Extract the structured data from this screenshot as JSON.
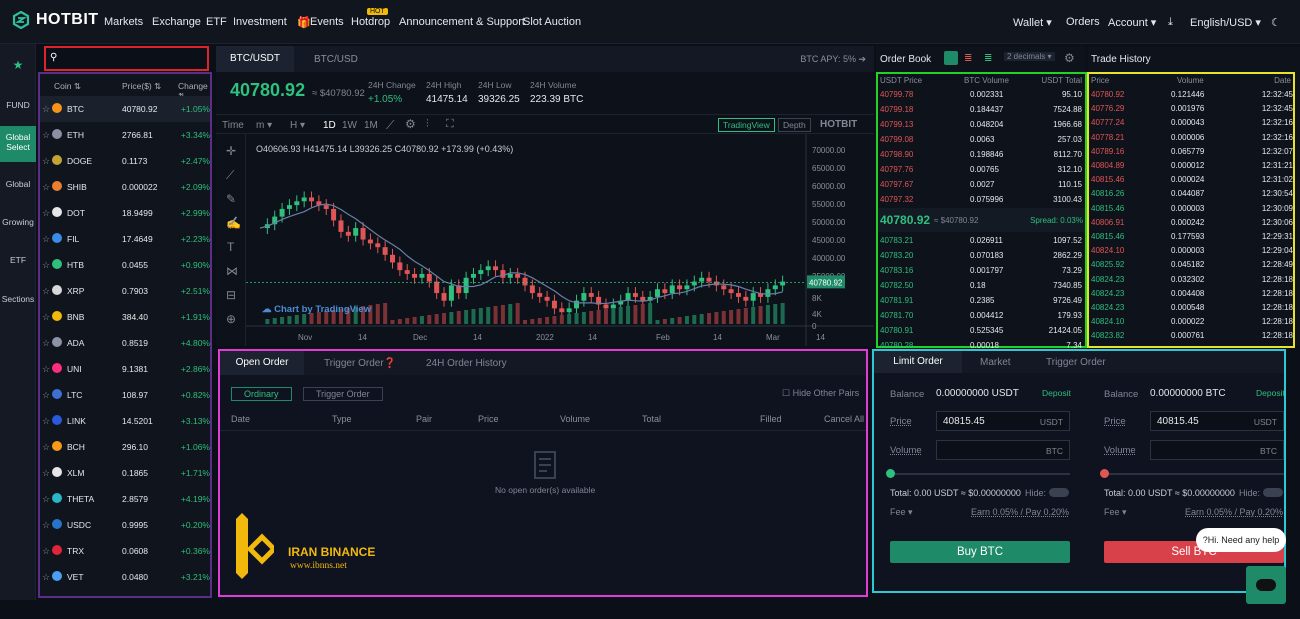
{
  "nav": {
    "brand": "HOTBIT",
    "items": [
      "Markets",
      "Exchange",
      "ETF",
      "Investment",
      "Events",
      "Hotdrop",
      "Announcement & Support",
      "Slot Auction"
    ],
    "hot_badge": "HOT",
    "right": [
      "Wallet",
      "Orders",
      "Account",
      "English/USD"
    ]
  },
  "leftbar": {
    "items": [
      "FUND",
      "Global Select",
      "Global",
      "Growing",
      "ETF",
      "Sections"
    ]
  },
  "coinlist": {
    "headers": [
      "Coin",
      "Price($)",
      "Change"
    ],
    "rows": [
      {
        "sym": "BTC",
        "price": "40780.92",
        "chg": "+1.05%",
        "color": "#f7931a"
      },
      {
        "sym": "ETH",
        "price": "2766.81",
        "chg": "+3.34%",
        "color": "#8a8fa3"
      },
      {
        "sym": "DOGE",
        "price": "0.1173",
        "chg": "+2.47%",
        "color": "#c2a633"
      },
      {
        "sym": "SHIB",
        "price": "0.000022",
        "chg": "+2.09%",
        "color": "#e8802f"
      },
      {
        "sym": "DOT",
        "price": "18.9499",
        "chg": "+2.99%",
        "color": "#e6e6e6"
      },
      {
        "sym": "FIL",
        "price": "17.4649",
        "chg": "+2.23%",
        "color": "#3b8be8"
      },
      {
        "sym": "HTB",
        "price": "0.0455",
        "chg": "+0.90%",
        "color": "#2fbf7e"
      },
      {
        "sym": "XRP",
        "price": "0.7903",
        "chg": "+2.51%",
        "color": "#d8d8d8"
      },
      {
        "sym": "BNB",
        "price": "384.40",
        "chg": "+1.91%",
        "color": "#f0b90b"
      },
      {
        "sym": "ADA",
        "price": "0.8519",
        "chg": "+4.80%",
        "color": "#8b93a6"
      },
      {
        "sym": "UNI",
        "price": "9.1381",
        "chg": "+2.86%",
        "color": "#ff2d7a"
      },
      {
        "sym": "LTC",
        "price": "108.97",
        "chg": "+0.82%",
        "color": "#3f6fd6"
      },
      {
        "sym": "LINK",
        "price": "14.5201",
        "chg": "+3.13%",
        "color": "#2a5ada"
      },
      {
        "sym": "BCH",
        "price": "296.10",
        "chg": "+1.06%",
        "color": "#f79a1a"
      },
      {
        "sym": "XLM",
        "price": "0.1865",
        "chg": "+1.71%",
        "color": "#e6e6e6"
      },
      {
        "sym": "THETA",
        "price": "2.8579",
        "chg": "+4.19%",
        "color": "#29b6c6"
      },
      {
        "sym": "USDC",
        "price": "0.9995",
        "chg": "+0.20%",
        "color": "#2775ca"
      },
      {
        "sym": "TRX",
        "price": "0.0608",
        "chg": "+0.36%",
        "color": "#e0243a"
      },
      {
        "sym": "VET",
        "price": "0.0480",
        "chg": "+3.21%",
        "color": "#4a9ff0"
      }
    ]
  },
  "chart": {
    "tabs": [
      "BTC/USDT",
      "BTC/USD"
    ],
    "apy": "BTC APY: 5%",
    "last_price": "40780.92",
    "last_usd": "≈ $40780.92",
    "stats": [
      {
        "label": "24H Change",
        "value": "+1.05%"
      },
      {
        "label": "24H High",
        "value": "41475.14"
      },
      {
        "label": "24H Low",
        "value": "39326.25"
      },
      {
        "label": "24H Volume",
        "value": "223.39 BTC"
      }
    ],
    "toolbar": [
      "Time",
      "m",
      "H",
      "1D",
      "1W",
      "1M"
    ],
    "view_buttons": [
      "TradingView",
      "Depth"
    ],
    "ohlc": "O40606.93 H41475.14 L39326.25 C40780.92 +173.99 (+0.43%)",
    "watermark": "Chart by TradingView",
    "yticks": [
      "70000.00",
      "65000.00",
      "60000.00",
      "55000.00",
      "50000.00",
      "45000.00",
      "40000.00",
      "35000.00",
      "8K",
      "4K",
      "0"
    ],
    "xticks": [
      "Nov",
      "14",
      "Dec",
      "14",
      "2022",
      "14",
      "Feb",
      "14",
      "Mar",
      "14"
    ],
    "price_tag": "40780.92"
  },
  "orderbook": {
    "title": "Order Book",
    "decimals": "2 decimals",
    "headers": [
      "USDT Price",
      "BTC Volume",
      "USDT Total"
    ],
    "asks": [
      [
        "40799.78",
        "0.002331",
        "95.10"
      ],
      [
        "40799.18",
        "0.184437",
        "7524.88"
      ],
      [
        "40799.13",
        "0.048204",
        "1966.68"
      ],
      [
        "40799.08",
        "0.0063",
        "257.03"
      ],
      [
        "40798.90",
        "0.198846",
        "8112.70"
      ],
      [
        "40797.76",
        "0.00765",
        "312.10"
      ],
      [
        "40797.67",
        "0.0027",
        "110.15"
      ],
      [
        "40797.32",
        "0.075996",
        "3100.43"
      ]
    ],
    "mid_price": "40780.92",
    "mid_usd": "≈ $40780.92",
    "spread": "Spread: 0.03%",
    "bids": [
      [
        "40783.21",
        "0.026911",
        "1097.52"
      ],
      [
        "40783.20",
        "0.070183",
        "2862.29"
      ],
      [
        "40783.16",
        "0.001797",
        "73.29"
      ],
      [
        "40782.50",
        "0.18",
        "7340.85"
      ],
      [
        "40781.91",
        "0.2385",
        "9726.49"
      ],
      [
        "40781.70",
        "0.004412",
        "179.93"
      ],
      [
        "40780.91",
        "0.525345",
        "21424.05"
      ],
      [
        "40780.28",
        "0.00018",
        "7.34"
      ]
    ]
  },
  "tradehistory": {
    "title": "Trade History",
    "headers": [
      "Price",
      "Volume",
      "Date"
    ],
    "rows": [
      [
        "40780.92",
        "0.121446",
        "12:32:45",
        "red"
      ],
      [
        "40776.29",
        "0.001976",
        "12:32:45",
        "red"
      ],
      [
        "40777.24",
        "0.000043",
        "12:32:16",
        "red"
      ],
      [
        "40778.21",
        "0.000006",
        "12:32:16",
        "red"
      ],
      [
        "40789.16",
        "0.065779",
        "12:32:07",
        "red"
      ],
      [
        "40804.89",
        "0.000012",
        "12:31:21",
        "red"
      ],
      [
        "40815.46",
        "0.000024",
        "12:31:02",
        "red"
      ],
      [
        "40816.26",
        "0.044087",
        "12:30:54",
        "green"
      ],
      [
        "40815.46",
        "0.000003",
        "12:30:09",
        "green"
      ],
      [
        "40806.91",
        "0.000242",
        "12:30:06",
        "red"
      ],
      [
        "40815.46",
        "0.177593",
        "12:29:31",
        "green"
      ],
      [
        "40824.10",
        "0.000003",
        "12:29:04",
        "red"
      ],
      [
        "40825.92",
        "0.045182",
        "12:28:49",
        "green"
      ],
      [
        "40824.23",
        "0.032302",
        "12:28:18",
        "green"
      ],
      [
        "40824.23",
        "0.004408",
        "12:28:18",
        "green"
      ],
      [
        "40824.23",
        "0.000548",
        "12:28:18",
        "green"
      ],
      [
        "40824.10",
        "0.000022",
        "12:28:18",
        "green"
      ],
      [
        "40823.82",
        "0.000761",
        "12:28:18",
        "green"
      ]
    ]
  },
  "orders": {
    "tabs": [
      "Open Order",
      "Trigger Order",
      "24H Order History"
    ],
    "subtabs": [
      "Ordinary",
      "Trigger Order"
    ],
    "hide_pairs": "Hide Other Pairs",
    "headers": [
      "Date",
      "Type",
      "Pair",
      "Price",
      "Volume",
      "Total",
      "Filled",
      "Cancel All"
    ],
    "empty": "No open order(s) available"
  },
  "watermark": {
    "name": "IRAN BINANCE",
    "url": "www.ibnns.net"
  },
  "trade": {
    "tabs": [
      "Limit Order",
      "Market",
      "Trigger Order"
    ],
    "buy": {
      "balance_label": "Balance",
      "balance": "0.00000000 USDT",
      "deposit": "Deposit",
      "price_label": "Price",
      "price": "40815.45",
      "price_unit": "USDT",
      "volume_label": "Volume",
      "volume_unit": "BTC",
      "total": "Total: 0.00 USDT ≈ $0.00000000",
      "hide": "Hide:",
      "fee": "Fee",
      "earn": "Earn 0.05% / Pay 0.20%",
      "button": "Buy BTC"
    },
    "sell": {
      "balance_label": "Balance",
      "balance": "0.00000000 BTC",
      "deposit": "Deposit",
      "price_label": "Price",
      "price": "40815.45",
      "price_unit": "USDT",
      "volume_label": "Volume",
      "volume_unit": "BTC",
      "total": "Total: 0.00 USDT ≈ $0.00000000",
      "hide": "Hide:",
      "fee": "Fee",
      "earn": "Earn 0.05% / Pay 0.20%",
      "button": "Sell BTC"
    },
    "chat_bubble": "?Hi. Need any help"
  }
}
